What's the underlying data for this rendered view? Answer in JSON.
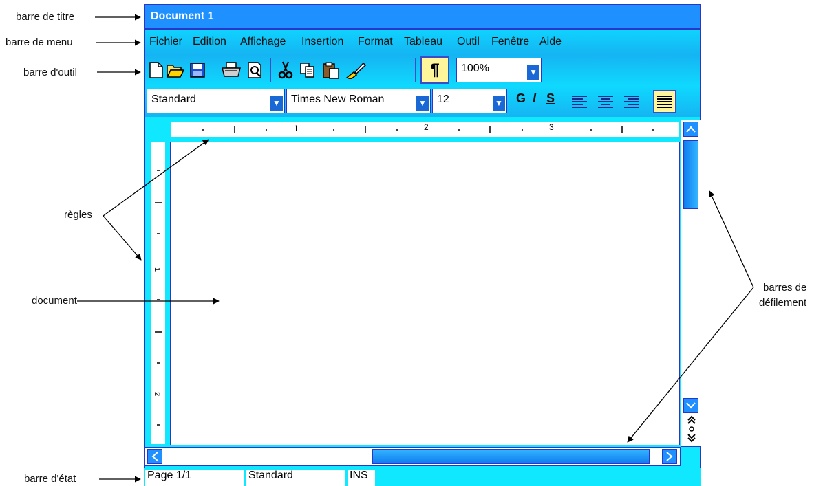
{
  "window": {
    "title": "Document 1"
  },
  "menu": [
    "Fichier",
    "Edition",
    "Affichage",
    "Insertion",
    "Format",
    "Tableau",
    "Outil",
    "Fenêtre",
    "Aide"
  ],
  "toolbar": {
    "icons": [
      "new-document-icon",
      "open-folder-icon",
      "save-icon",
      "print-icon",
      "print-preview-icon",
      "cut-icon",
      "copy-icon",
      "paste-icon",
      "format-painter-icon",
      "pilcrow-icon"
    ],
    "pilcrow": "¶",
    "zoom": "100%"
  },
  "formatbar": {
    "style": "Standard",
    "font": "Times New Roman",
    "size": "12",
    "bold": "G",
    "italic": "I",
    "underline": "S"
  },
  "ruler": {
    "h_labels": [
      "1",
      "2",
      "3"
    ],
    "v_labels": [
      "1",
      "2"
    ]
  },
  "status": {
    "page": "Page 1/1",
    "style": "Standard",
    "mode": "INS"
  },
  "annotations": {
    "title_bar": "barre de titre",
    "menu_bar": "barre de menu",
    "toolbar": "barre d'outil",
    "rulers": "règles",
    "document": "document",
    "status_bar": "barre d'état",
    "scrollbars_line1": "barres de",
    "scrollbars_line2": "défilement"
  },
  "colors": {
    "titlebar": "#1e90ff",
    "menubar": "#0fd3ff",
    "border": "#2a36c8",
    "highlight": "#fff59b"
  }
}
